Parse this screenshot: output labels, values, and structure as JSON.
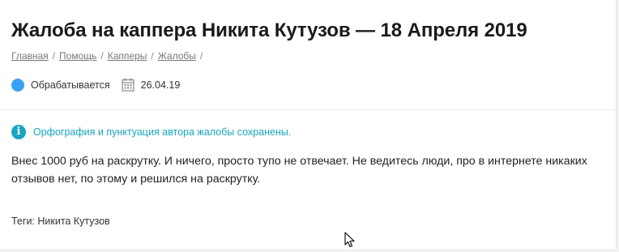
{
  "page": {
    "title": "Жалоба на каппера Никита Кутузов — 18 Апреля 2019"
  },
  "breadcrumb": {
    "items": [
      "Главная",
      "Помощь",
      "Капперы",
      "Жалобы"
    ],
    "separator": "/"
  },
  "meta": {
    "status_label": "Обрабатывается",
    "status_color": "#3aa0f2",
    "date": "26.04.19",
    "date_icon": "calendar-icon"
  },
  "notice": {
    "icon": "info-icon",
    "text": "Орфография и пунктуация автора жалобы сохранены.",
    "color": "#18a6c0"
  },
  "complaint": {
    "text": "Внес 1000 руб на раскрутку. И ничего, просто тупо не отвечает. Не ведитесь люди, про в интернете никаких отзывов нет, по этому и решился на раскрутку."
  },
  "tags": {
    "text": "Теги: Никита Кутузов"
  }
}
